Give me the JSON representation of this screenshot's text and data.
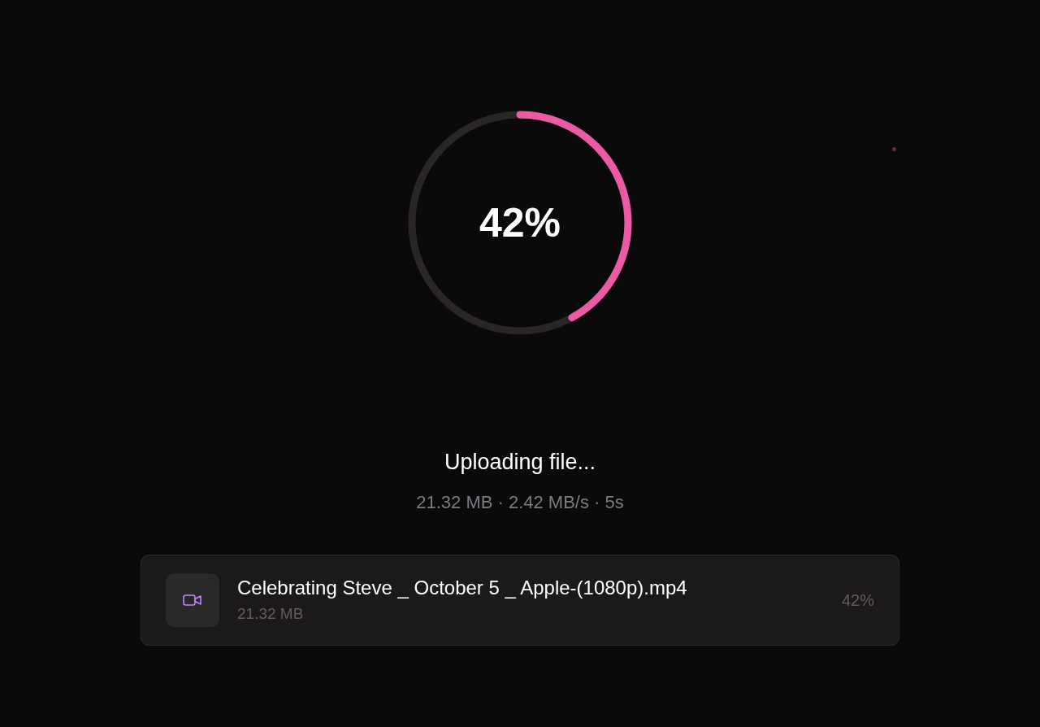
{
  "progress": {
    "level": 0.42,
    "reading": "42%"
  },
  "status": {
    "title": "Uploading file...",
    "details": "21.32 MB · 2.42 MB/s · 5s"
  },
  "files": [
    {
      "kind": "video",
      "name": "Celebrating Steve _ October 5 _ Apple-(1080p).mp4",
      "size": "21.32 MB",
      "percent": "42%"
    }
  ]
}
